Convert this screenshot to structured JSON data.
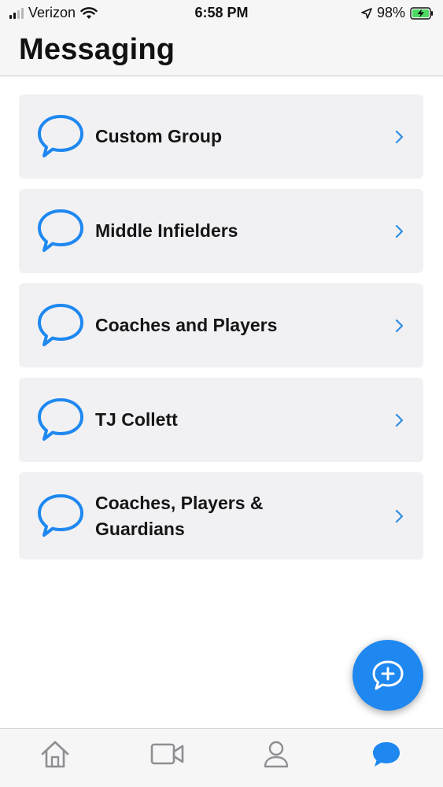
{
  "status_bar": {
    "carrier": "Verizon",
    "time": "6:58 PM",
    "battery_percent": "98%",
    "icons": [
      "signal-icon",
      "wifi-icon",
      "location-icon",
      "battery-charging-icon"
    ]
  },
  "header": {
    "title": "Messaging"
  },
  "groups": [
    {
      "label": "Custom Group",
      "icon": "chat-bubble-icon"
    },
    {
      "label": "Middle Infielders",
      "icon": "chat-bubble-icon"
    },
    {
      "label": "Coaches and Players",
      "icon": "chat-bubble-icon"
    },
    {
      "label": "TJ Collett",
      "icon": "chat-bubble-icon"
    },
    {
      "label": "Coaches, Players & Guardians",
      "icon": "chat-bubble-icon"
    }
  ],
  "fab": {
    "icon": "new-message-icon"
  },
  "tab_bar": {
    "tabs": [
      {
        "icon": "home-icon",
        "active": false
      },
      {
        "icon": "video-icon",
        "active": false
      },
      {
        "icon": "profile-icon",
        "active": false
      },
      {
        "icon": "chat-icon",
        "active": true
      }
    ]
  },
  "colors": {
    "accent": "#1e88f0",
    "inactive_icon": "#8e8e93",
    "card_bg": "#f1f1f4",
    "chevron": "#2f8de4"
  }
}
